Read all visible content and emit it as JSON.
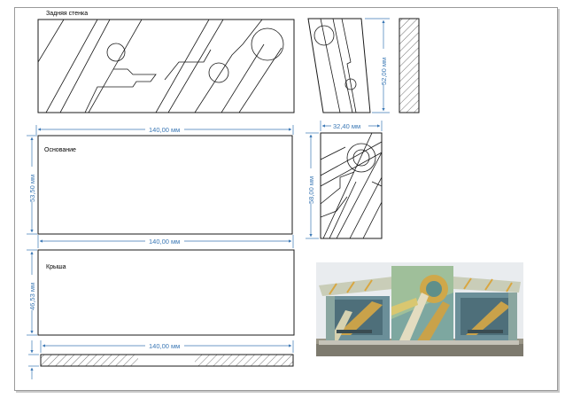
{
  "labels": {
    "back_wall": "Задняя стенка",
    "base": "Основание",
    "roof": "Крыша"
  },
  "dimensions": {
    "top_height": "52,00 мм",
    "side_width": "32,40 мм",
    "base_width": "140,00 мм",
    "base_height": "53,50 мм",
    "side_height": "58,00 мм",
    "roof_width": "140,00 мм",
    "roof_height": "46,53 мм",
    "strip_width": "140,00 мм"
  },
  "colors": {
    "dimension": "#3b78b5",
    "ink": "#1a1a1a"
  }
}
